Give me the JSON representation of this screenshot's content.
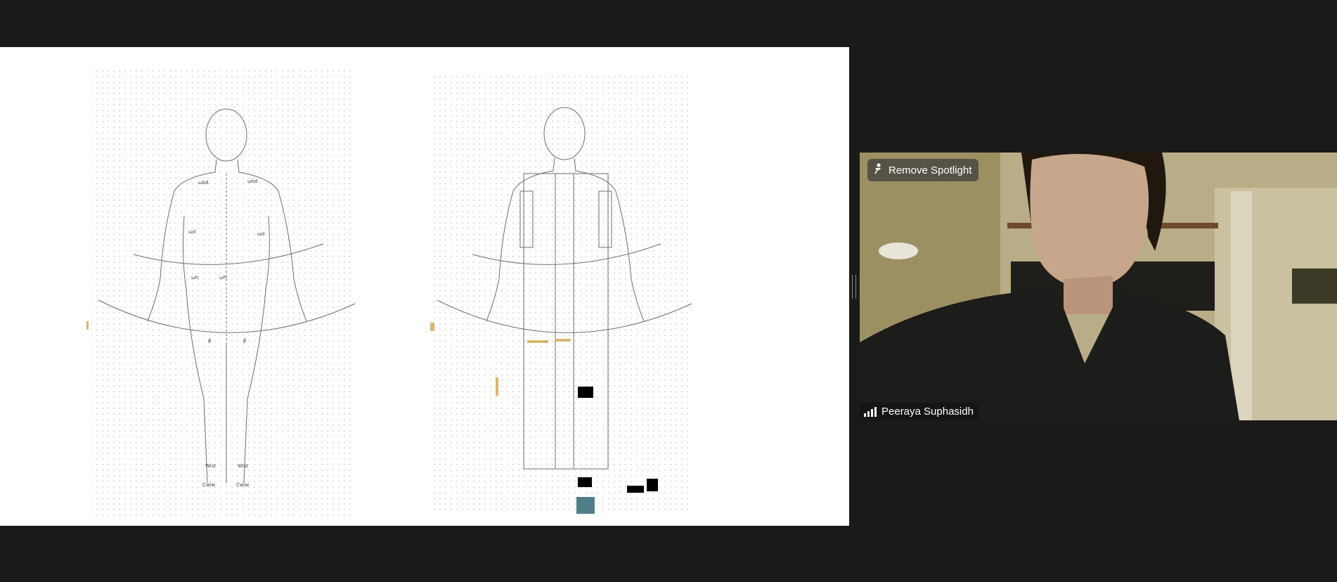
{
  "shared_screen": {
    "content": "two pencil figure drawings on dotted grid paper"
  },
  "video": {
    "spotlight_button": {
      "label": "Remove Spotlight",
      "icon": "pin-icon"
    },
    "participant_name": "Peeraya Suphasidh",
    "signal_icon": "signal-bars-icon",
    "colors": {
      "wall": "#b8ad86",
      "shirt": "#1c1c1a",
      "skin": "#c7a78c"
    }
  }
}
